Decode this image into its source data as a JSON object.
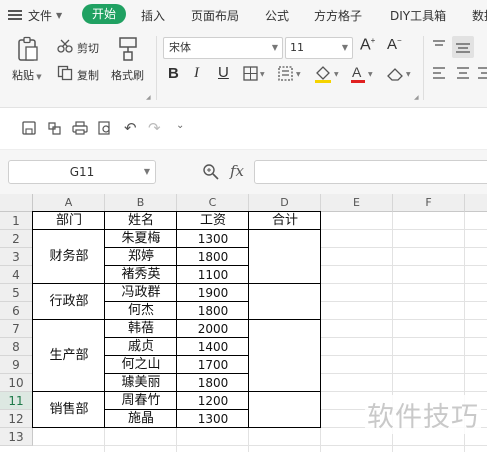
{
  "menu": {
    "file_label": "文件"
  },
  "tabs": {
    "active": "开始",
    "items": [
      "插入",
      "页面布局",
      "公式",
      "方方格子",
      "DIY工具箱",
      "数据"
    ]
  },
  "ribbon": {
    "paste_label": "粘贴",
    "cut_label": "剪切",
    "copy_label": "复制",
    "format_painter_label": "格式刷",
    "font_name": "宋体",
    "font_size": "11"
  },
  "formula_bar": {
    "cell_ref": "G11",
    "fx_label": "fx",
    "formula": ""
  },
  "sheet": {
    "columns": [
      "A",
      "B",
      "C",
      "D",
      "E",
      "F"
    ],
    "rows": [
      "1",
      "2",
      "3",
      "4",
      "5",
      "6",
      "7",
      "8",
      "9",
      "10",
      "11",
      "12",
      "13"
    ],
    "selected_row": "11",
    "headers": [
      "部门",
      "姓名",
      "工资",
      "合计"
    ],
    "departments": [
      "财务部",
      "行政部",
      "生产部",
      "销售部"
    ],
    "names": [
      "朱夏梅",
      "郑婷",
      "褚秀英",
      "冯政群",
      "何杰",
      "韩蓓",
      "戚贞",
      "何之山",
      "璩美丽",
      "周春竹",
      "施晶"
    ],
    "salaries": [
      "1300",
      "1800",
      "1100",
      "1900",
      "1800",
      "2000",
      "1400",
      "1700",
      "1800",
      "1200",
      "1300"
    ]
  },
  "watermark": "软件技巧",
  "colors": {
    "accent": "#20a162",
    "grid": "#e2e2e2",
    "header_bg": "#efefef"
  }
}
